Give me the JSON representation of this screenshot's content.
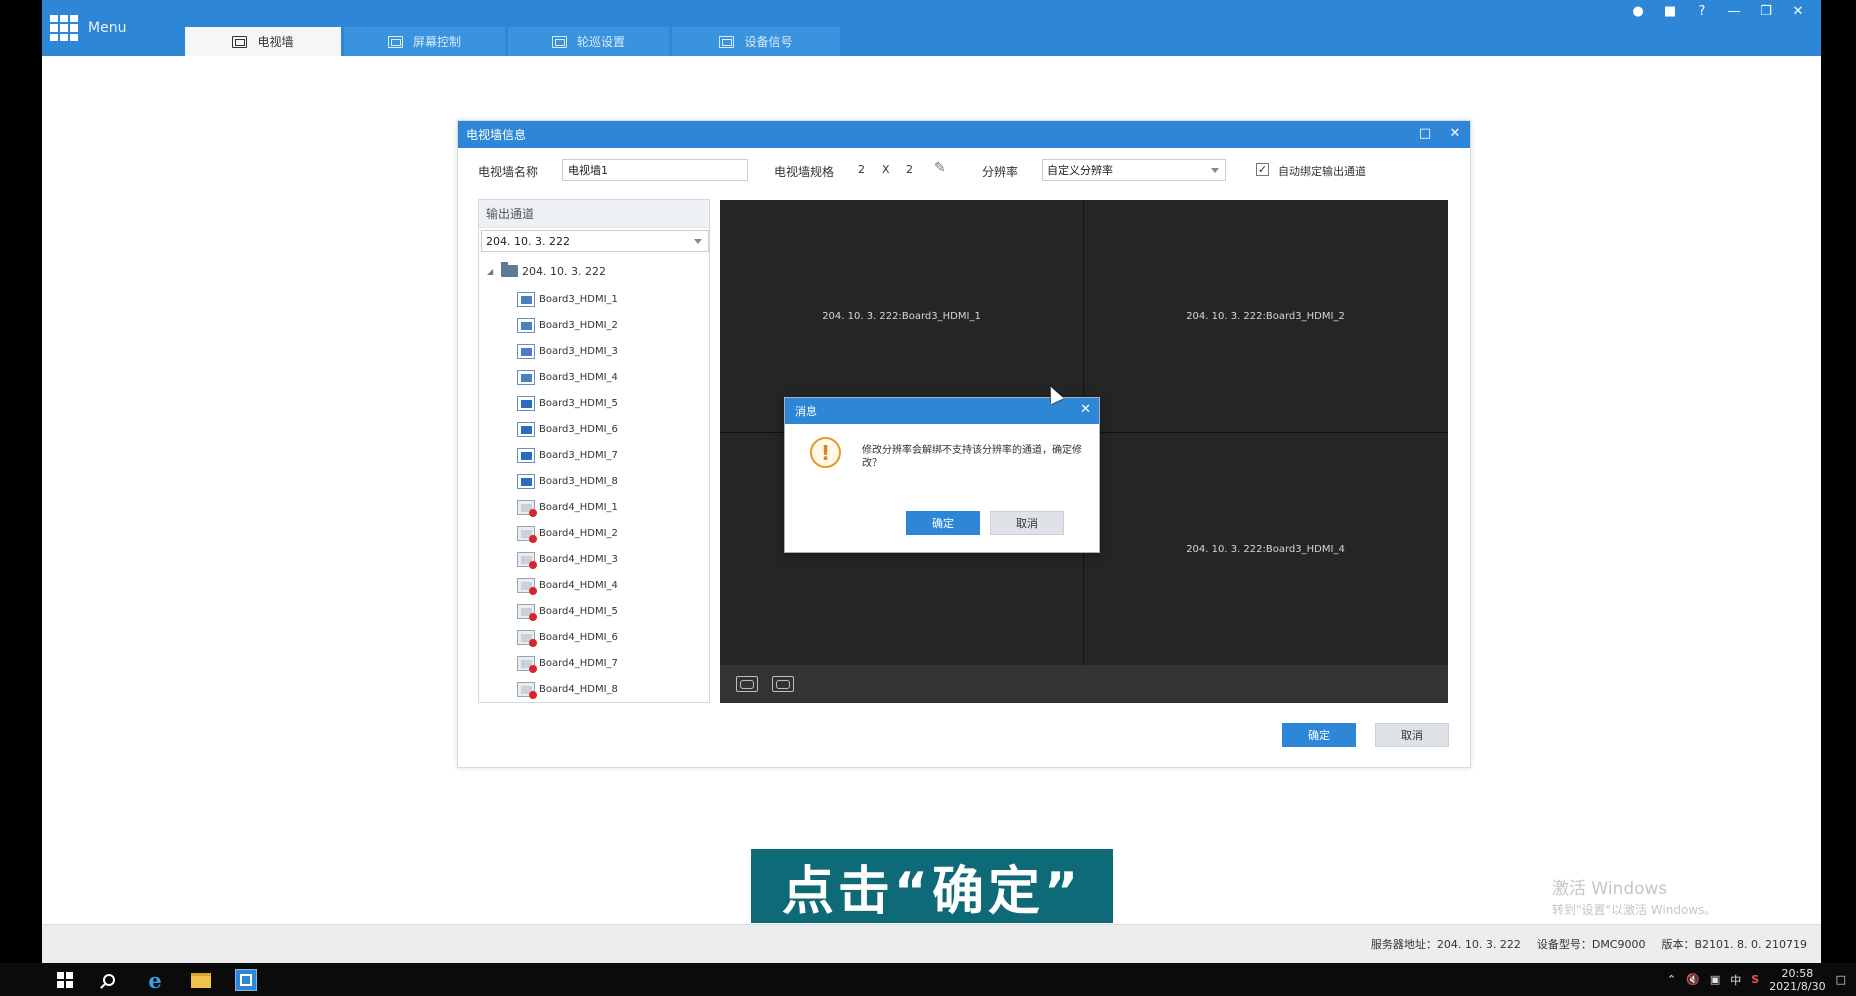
{
  "app": {
    "menu_label": "Menu",
    "tabs": [
      {
        "label": "电视墙",
        "active": true
      },
      {
        "label": "屏幕控制",
        "active": false
      },
      {
        "label": "轮巡设置",
        "active": false
      },
      {
        "label": "设备信号",
        "active": false
      }
    ],
    "window_controls": [
      "user-icon",
      "lock-icon",
      "help-icon",
      "minimize-icon",
      "restore-icon",
      "close-icon"
    ]
  },
  "wall_dialog": {
    "title": "电视墙信息",
    "name_label": "电视墙名称",
    "name_value": "电视墙1",
    "spec_label": "电视墙规格",
    "spec_rows": "2",
    "spec_x": "X",
    "spec_cols": "2",
    "resolution_label": "分辨率",
    "resolution_value": "自定义分辨率",
    "auto_bind_label": "自动绑定输出通道",
    "auto_bind_checked": true,
    "ok_label": "确定",
    "cancel_label": "取消"
  },
  "tree": {
    "header": "输出通道",
    "device_select": "204. 10. 3. 222",
    "root_label": "204. 10. 3. 222",
    "items": [
      {
        "label": "Board3_HDMI_1",
        "status": "bound"
      },
      {
        "label": "Board3_HDMI_2",
        "status": "bound"
      },
      {
        "label": "Board3_HDMI_3",
        "status": "bound"
      },
      {
        "label": "Board3_HDMI_4",
        "status": "bound"
      },
      {
        "label": "Board3_HDMI_5",
        "status": "online"
      },
      {
        "label": "Board3_HDMI_6",
        "status": "online"
      },
      {
        "label": "Board3_HDMI_7",
        "status": "online"
      },
      {
        "label": "Board3_HDMI_8",
        "status": "online"
      },
      {
        "label": "Board4_HDMI_1",
        "status": "offline"
      },
      {
        "label": "Board4_HDMI_2",
        "status": "offline"
      },
      {
        "label": "Board4_HDMI_3",
        "status": "offline"
      },
      {
        "label": "Board4_HDMI_4",
        "status": "offline"
      },
      {
        "label": "Board4_HDMI_5",
        "status": "offline"
      },
      {
        "label": "Board4_HDMI_6",
        "status": "offline"
      },
      {
        "label": "Board4_HDMI_7",
        "status": "offline"
      },
      {
        "label": "Board4_HDMI_8",
        "status": "offline"
      }
    ]
  },
  "wall_screens": [
    {
      "label": "204. 10. 3. 222:Board3_HDMI_1"
    },
    {
      "label": "204. 10. 3. 222:Board3_HDMI_2"
    },
    {
      "label": ""
    },
    {
      "label": "204. 10. 3. 222:Board3_HDMI_4"
    }
  ],
  "message": {
    "title": "消息",
    "text": "修改分辨率会解绑不支持该分辨率的通道，确定修改？",
    "ok_label": "确定",
    "cancel_label": "取消"
  },
  "caption": "点击“确定”",
  "watermark": {
    "line1": "激活 Windows",
    "line2": "转到\"设置\"以激活 Windows。"
  },
  "statusbar": {
    "server_label": "服务器地址：",
    "server_value": "204. 10. 3. 222",
    "model_label": "设备型号：",
    "model_value": "DMC9000",
    "version_label": "版本：",
    "version_value": "B2101. 8. 0. 210719"
  },
  "taskbar": {
    "time": "20:58",
    "date": "2021/8/30",
    "ime": "中"
  },
  "colors": {
    "accent": "#2e87d6",
    "wall_bg": "#252525",
    "offline_dot": "#d8262b",
    "caption_bg": "#0f6a78"
  }
}
